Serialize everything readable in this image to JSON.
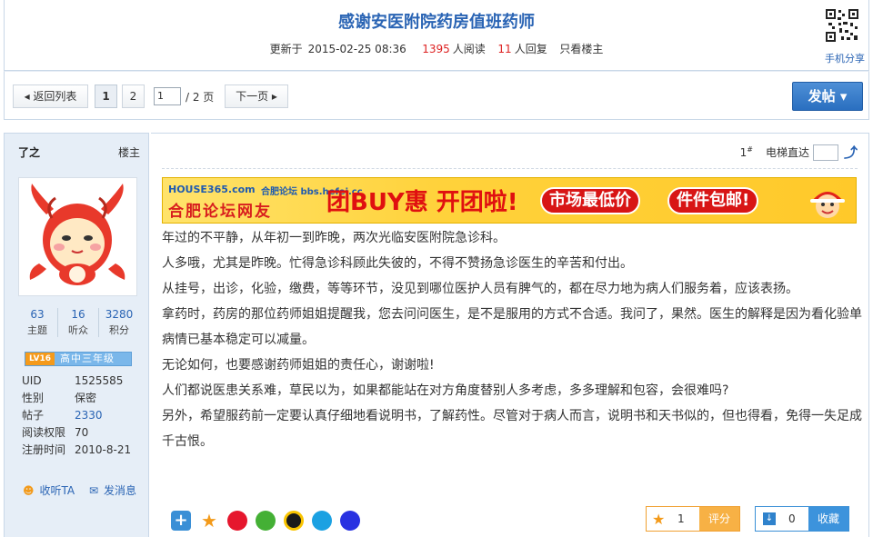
{
  "header": {
    "title": "感谢安医附院药房值班药师",
    "updated_label": "更新于",
    "updated_time": "2015-02-25 08:36",
    "reads_count": "1395",
    "reads_label": "人阅读",
    "replies_count": "11",
    "replies_label": "人回复",
    "only_op": "只看楼主",
    "mobile_share": "手机分享"
  },
  "toolbar": {
    "back_label": "◂ 返回列表",
    "pages": [
      "1",
      "2"
    ],
    "current_page": "1",
    "page_total": "/ 2 页",
    "next_label": "下一页 ▸",
    "post_label": "发帖 ▾"
  },
  "user": {
    "name": "了之",
    "role": "楼主",
    "stats": [
      {
        "value": "63",
        "label": "主题"
      },
      {
        "value": "16",
        "label": "听众"
      },
      {
        "value": "3280",
        "label": "积分"
      }
    ],
    "level_badge": "LV16",
    "level_title": "高中三年级",
    "info": [
      {
        "key": "UID",
        "value": "1525585",
        "blue": false
      },
      {
        "key": "性别",
        "value": "保密",
        "blue": false
      },
      {
        "key": "帖子",
        "value": "2330",
        "blue": true
      },
      {
        "key": "阅读权限",
        "value": "70",
        "blue": false
      },
      {
        "key": "注册时间",
        "value": "2010-8-21",
        "blue": false
      }
    ],
    "follow_label": "收听TA",
    "message_label": "发消息"
  },
  "post": {
    "floor": "1",
    "floor_suffix": "#",
    "elevator_label": "电梯直达",
    "banner": {
      "logo_top": "HOUSE365.com",
      "logo_main": "合肥论坛网友",
      "site": "合肥论坛 bbs.hefei.cc",
      "headline": "团BUY惠 开团啦!",
      "pill1": "市场最低价",
      "pill2": "件件包邮!"
    },
    "paragraphs": [
      "年过的不平静，从年初一到昨晚，两次光临安医附院急诊科。",
      "人多哦，尤其是昨晚。忙得急诊科顾此失彼的，不得不赞扬急诊医生的辛苦和付出。",
      "从挂号，出诊，化验，缴费，等等环节，没见到哪位医护人员有脾气的，都在尽力地为病人们服务着，应该表扬。",
      "拿药时，药房的那位药师姐姐提醒我，您去问问医生，是不是服用的方式不合适。我问了，果然。医生的解释是因为看化验单病情已基本稳定可以减量。",
      "无论如何，也要感谢药师姐姐的责任心，谢谢啦!",
      "人们都说医患关系难，草民以为，如果都能站在对方角度替别人多考虑，多多理解和包容，会很难吗?",
      "另外，希望服药前一定要认真仔细地看说明书，了解药性。尽管对于病人而言，说明书和天书似的，但也得看，免得一失足成千古恨。"
    ],
    "rate_count": "1",
    "rate_label": "评分",
    "fav_count": "0",
    "fav_label": "收藏"
  },
  "colors": {
    "link_blue": "#2a64b4",
    "count_red": "#d22222",
    "post_button": "#2a6fc0",
    "rate_orange": "#f7b145",
    "fav_blue": "#3c93dc"
  }
}
